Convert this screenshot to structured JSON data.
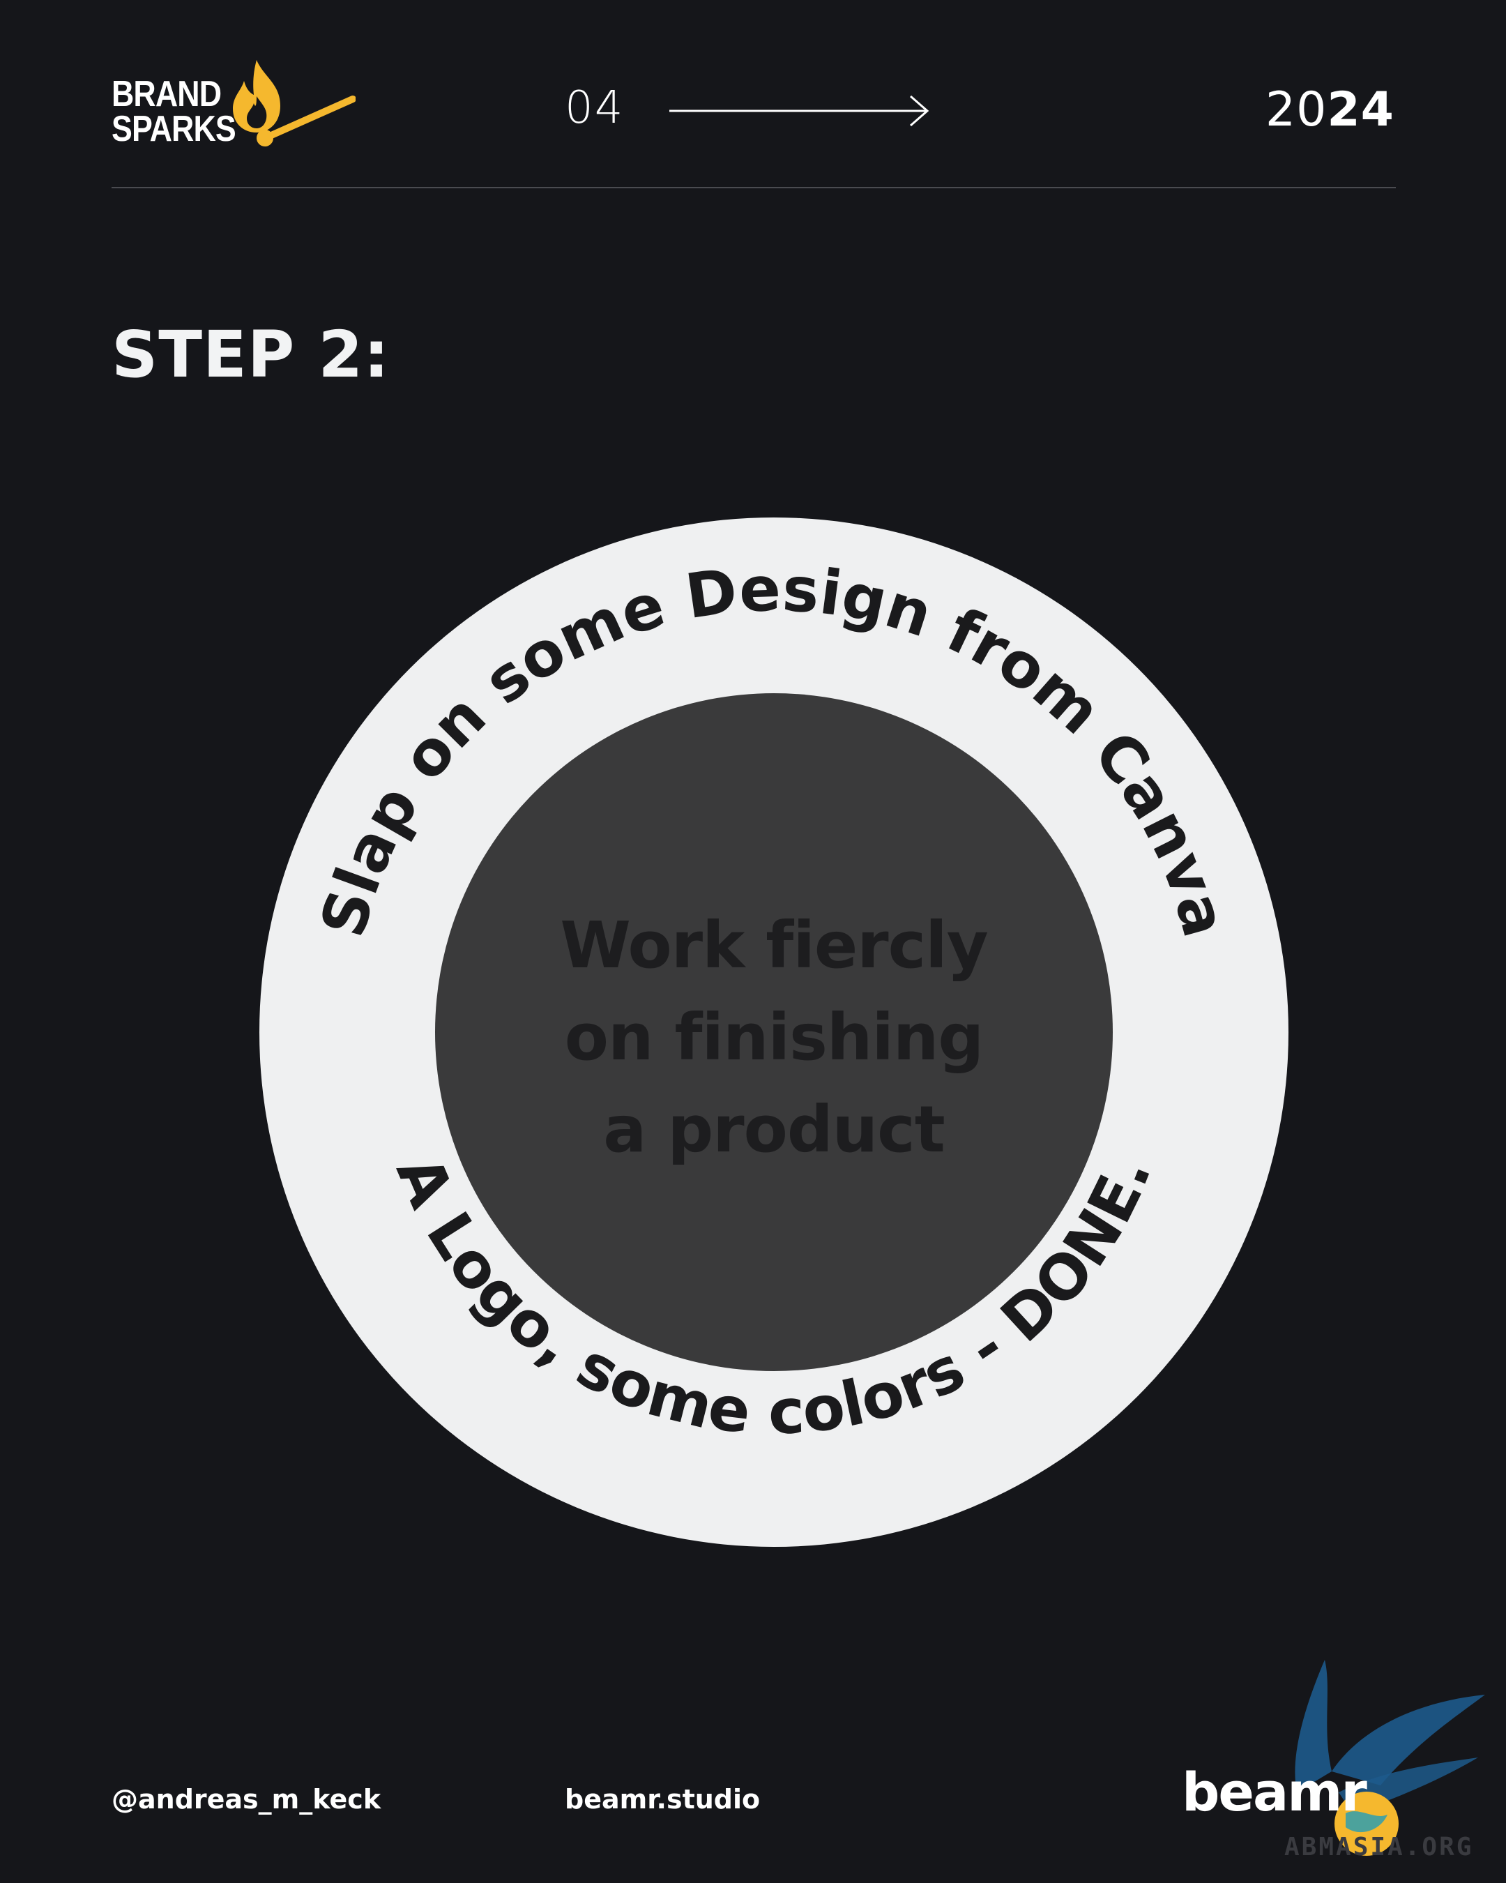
{
  "header": {
    "brand_line1": "BRAND",
    "brand_line2": "SPARKS",
    "page_number": "04",
    "year_light": "20",
    "year_bold": "24"
  },
  "title": "STEP 2:",
  "circle": {
    "outer_arc_top": "Slap on some Design from Canva",
    "outer_arc_bottom": "A Logo, some colors - DONE.",
    "inner_lines": [
      "Work fiercly",
      "on finishing",
      "a product"
    ]
  },
  "footer": {
    "handle": "@andreas_m_keck",
    "site": "beamr.studio",
    "logo_text": "beamr",
    "watermark_text": "ABMASIA.ORG"
  },
  "colors": {
    "background": "#15161a",
    "ring": "#eff0f1",
    "inner_circle": "#3a3a3b",
    "accent": "#f5b82e",
    "watermark_blue": "#1d5a8c"
  },
  "icons": {
    "brand": "flame-match-icon",
    "next": "arrow-right-icon",
    "watermark": "bird-globe-icon"
  }
}
